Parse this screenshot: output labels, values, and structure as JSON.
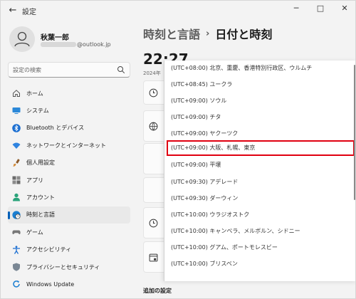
{
  "window": {
    "title": "設定",
    "back_icon": "arrow-left-icon",
    "controls": {
      "minimize": "─",
      "maximize": "□",
      "close": "✕"
    }
  },
  "account": {
    "name": "秋葉一郎",
    "email_suffix": "@outlook.jp"
  },
  "search": {
    "placeholder": "設定の検索"
  },
  "sidebar": {
    "items": [
      {
        "label": "ホーム",
        "icon": "home-icon",
        "active": false
      },
      {
        "label": "システム",
        "icon": "system-icon",
        "active": false
      },
      {
        "label": "Bluetooth とデバイス",
        "icon": "bluetooth-icon",
        "active": false
      },
      {
        "label": "ネットワークとインターネット",
        "icon": "wifi-icon",
        "active": false
      },
      {
        "label": "個人用設定",
        "icon": "paintbrush-icon",
        "active": false
      },
      {
        "label": "アプリ",
        "icon": "apps-icon",
        "active": false
      },
      {
        "label": "アカウント",
        "icon": "person-icon",
        "active": false
      },
      {
        "label": "時刻と言語",
        "icon": "globe-clock-icon",
        "active": true
      },
      {
        "label": "ゲーム",
        "icon": "gamepad-icon",
        "active": false
      },
      {
        "label": "アクセシビリティ",
        "icon": "accessibility-icon",
        "active": false
      },
      {
        "label": "プライバシーとセキュリティ",
        "icon": "shield-icon",
        "active": false
      },
      {
        "label": "Windows Update",
        "icon": "update-icon",
        "active": false
      }
    ]
  },
  "main": {
    "breadcrumb_parent": "時刻と言語",
    "breadcrumb_sep": "›",
    "breadcrumb_current": "日付と時刻",
    "clock": "22:27",
    "date": "2024年",
    "extra_settings_title": "追加の設定"
  },
  "timezone_dropdown": {
    "options": [
      "(UTC+08:00) 北京、重慶、香港特別行政区、ウルムチ",
      "(UTC+08:45) ユークラ",
      "(UTC+09:00) ソウル",
      "(UTC+09:00) チタ",
      "(UTC+09:00) ヤクーツク",
      "(UTC+09:00) 大阪、札幌、東京",
      "(UTC+09:00) 平壌",
      "(UTC+09:30) アデレード",
      "(UTC+09:30) ダーウィン",
      "(UTC+10:00) ウラジオストク",
      "(UTC+10:00) キャンベラ、メルボルン、シドニー",
      "(UTC+10:00) グアム、ポートモレスビー",
      "(UTC+10:00) ブリスベン"
    ],
    "highlighted_index": 5
  },
  "colors": {
    "accent": "#005fb8",
    "highlight_border": "#e00010",
    "window_bg": "#f3f3f3"
  }
}
